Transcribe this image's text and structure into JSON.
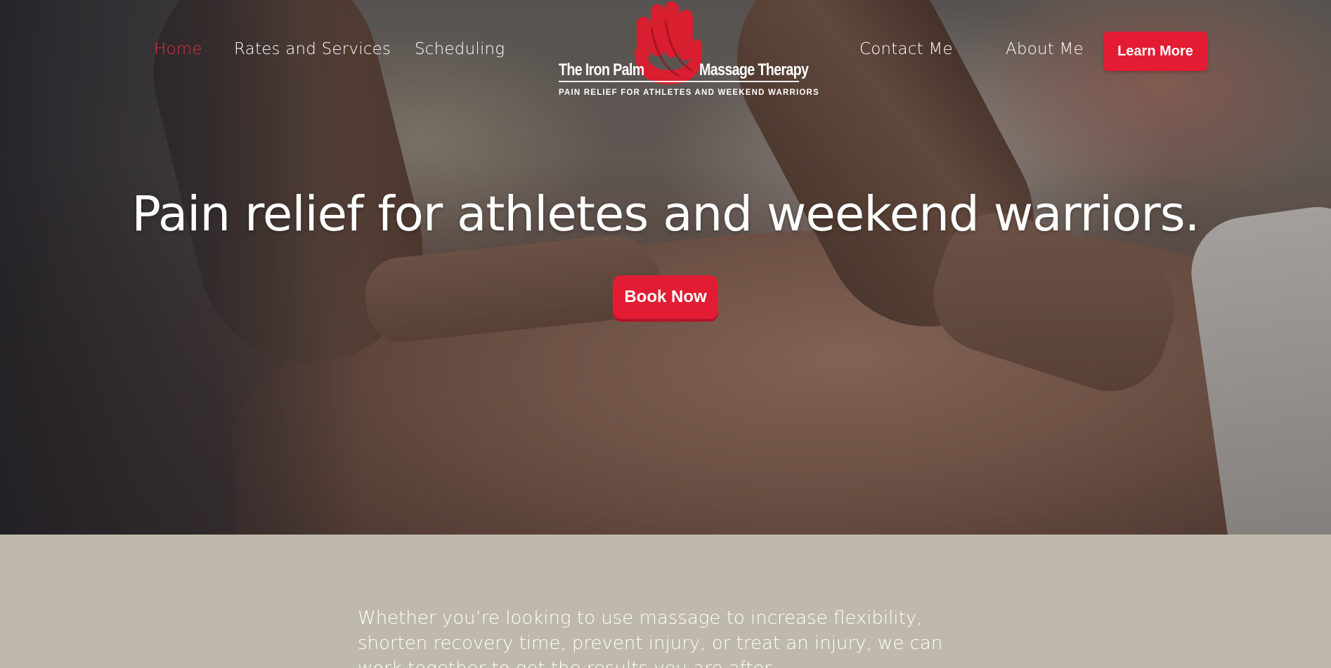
{
  "nav": {
    "left": [
      {
        "label": "Home",
        "active": true
      },
      {
        "label": "Rates and Services",
        "active": false
      },
      {
        "label": "Scheduling",
        "active": false
      }
    ],
    "right": [
      {
        "label": "Contact Me"
      },
      {
        "label": "About Me"
      }
    ],
    "cta": "Learn More"
  },
  "logo": {
    "name_left": "The Iron Palm",
    "name_right": "Massage Therapy",
    "tagline": "PAIN RELIEF FOR ATHLETES AND WEEKEND WARRIORS",
    "icon": "red-hand-icon"
  },
  "hero": {
    "headline": "Pain relief for athletes and weekend warriors.",
    "button": "Book Now"
  },
  "intro": {
    "text": "Whether you’re looking to use massage to increase flexibility, shorten recovery time, prevent injury, or treat an injury, we can work together to get the results you are after."
  },
  "colors": {
    "accent": "#e31c33",
    "section_bg": "#bfb9ab",
    "text": "#ffffff"
  }
}
